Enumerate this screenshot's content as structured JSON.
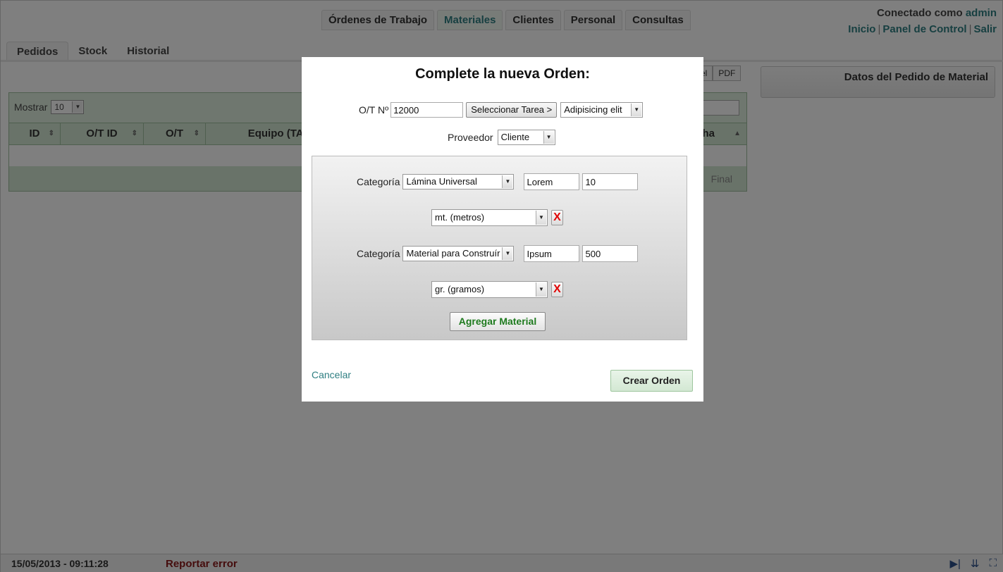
{
  "nav": {
    "tabs": [
      {
        "label": "Órdenes de Trabajo"
      },
      {
        "label": "Materiales",
        "active": true
      },
      {
        "label": "Clientes"
      },
      {
        "label": "Personal"
      },
      {
        "label": "Consultas"
      }
    ]
  },
  "user": {
    "prefix": "Conectado como",
    "name": "admin",
    "links": {
      "home": "Inicio",
      "panel": "Panel de Control",
      "logout": "Salir"
    },
    "separator": "|"
  },
  "subtabs": [
    {
      "label": "Pedidos",
      "active": true
    },
    {
      "label": "Stock"
    },
    {
      "label": "Historial"
    }
  ],
  "export": {
    "excel": "el",
    "pdf": "PDF"
  },
  "table": {
    "show_label": "Mostrar",
    "show_value": "10",
    "columns": [
      "ID",
      "O/T ID",
      "O/T",
      "Equipo (TAG",
      "ha"
    ],
    "footer_text": "Final"
  },
  "side_panel": {
    "title": "Datos del Pedido de Material"
  },
  "status": {
    "datetime": "15/05/2013 - 09:11:28",
    "report_error": "Reportar error"
  },
  "modal": {
    "title": "Complete la nueva Orden:",
    "ot_label": "O/T Nº",
    "ot_value": "12000",
    "select_task_button": "Seleccionar Tarea >",
    "task_value": "Adipisicing elit",
    "provider_label": "Proveedor",
    "provider_value": "Cliente",
    "materials": [
      {
        "category_label": "Categoría",
        "category": "Lámina Universal",
        "name": "Lorem",
        "quantity": "10",
        "unit": "mt. (metros)",
        "remove": "X"
      },
      {
        "category_label": "Categoría",
        "category": "Material para Construír",
        "name": "Ipsum",
        "quantity": "500",
        "unit": "gr. (gramos)",
        "remove": "X"
      }
    ],
    "add_material_button": "Agregar Material",
    "cancel_link": "Cancelar",
    "create_button": "Crear Orden"
  },
  "colors": {
    "accent": "#2f7f82",
    "success_text": "#1e7a1e",
    "danger": "#e00000",
    "error_link": "#8b1a1a"
  }
}
